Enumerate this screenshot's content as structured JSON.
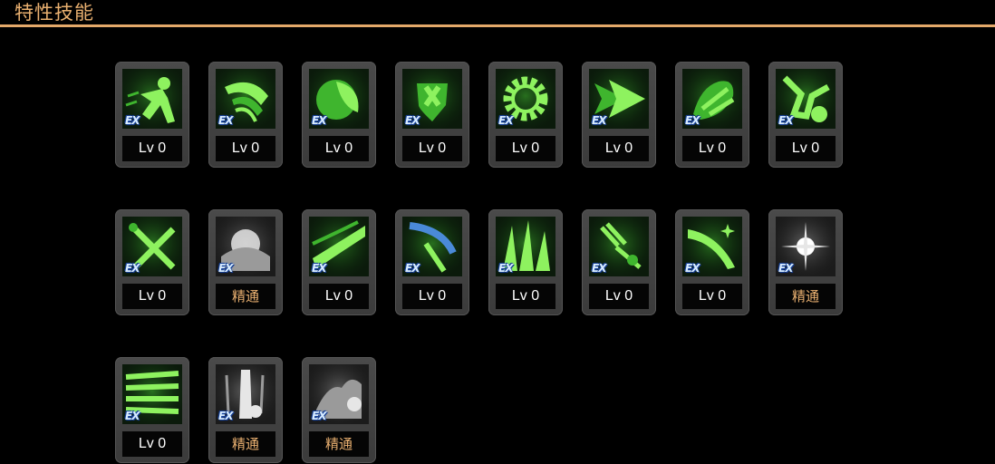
{
  "header": {
    "title": "特性技能"
  },
  "colors": {
    "accent": "#e4a96a",
    "title_text": "#e9b070",
    "level_text": "#ffffff",
    "master_text": "#e9b070",
    "card_bg": "#3f3f3f",
    "green_icon": "#7fe35a",
    "gray_icon": "#cfcfcf"
  },
  "skills": [
    {
      "icon": "green-figure-icon",
      "badge": "EX",
      "level": "Lv 0",
      "tone": "green"
    },
    {
      "icon": "green-claw-slash-icon",
      "badge": "EX",
      "level": "Lv 0",
      "tone": "green"
    },
    {
      "icon": "green-leaf-orb-icon",
      "badge": "EX",
      "level": "Lv 0",
      "tone": "green"
    },
    {
      "icon": "green-shield-cross-icon",
      "badge": "EX",
      "level": "Lv 0",
      "tone": "green"
    },
    {
      "icon": "green-gear-icon",
      "badge": "EX",
      "level": "Lv 0",
      "tone": "green"
    },
    {
      "icon": "green-arrow-burst-icon",
      "badge": "EX",
      "level": "Lv 0",
      "tone": "green"
    },
    {
      "icon": "green-splash-icon",
      "badge": "EX",
      "level": "Lv 0",
      "tone": "green"
    },
    {
      "icon": "green-kick-icon",
      "badge": "EX",
      "level": "Lv 0",
      "tone": "green"
    },
    {
      "icon": "green-crossed-swords-icon",
      "badge": "EX",
      "level": "Lv 0",
      "tone": "green"
    },
    {
      "icon": "gray-explosion-icon",
      "badge": "EX",
      "level": "精通",
      "tone": "gray"
    },
    {
      "icon": "green-wave-slash-icon",
      "badge": "EX",
      "level": "Lv 0",
      "tone": "green"
    },
    {
      "icon": "green-blue-strike-icon",
      "badge": "EX",
      "level": "Lv 0",
      "tone": "green"
    },
    {
      "icon": "green-rising-flames-icon",
      "badge": "EX",
      "level": "Lv 0",
      "tone": "green"
    },
    {
      "icon": "green-shatter-icon",
      "badge": "EX",
      "level": "Lv 0",
      "tone": "green"
    },
    {
      "icon": "green-sparkle-slash-icon",
      "badge": "EX",
      "level": "Lv 0",
      "tone": "green"
    },
    {
      "icon": "gray-flash-icon",
      "badge": "EX",
      "level": "精通",
      "tone": "gray"
    },
    {
      "icon": "green-speed-lines-icon",
      "badge": "EX",
      "level": "Lv 0",
      "tone": "green"
    },
    {
      "icon": "gray-pillar-icon",
      "badge": "EX",
      "level": "精通",
      "tone": "gray"
    },
    {
      "icon": "gray-impact-icon",
      "badge": "EX",
      "level": "精通",
      "tone": "gray"
    }
  ]
}
